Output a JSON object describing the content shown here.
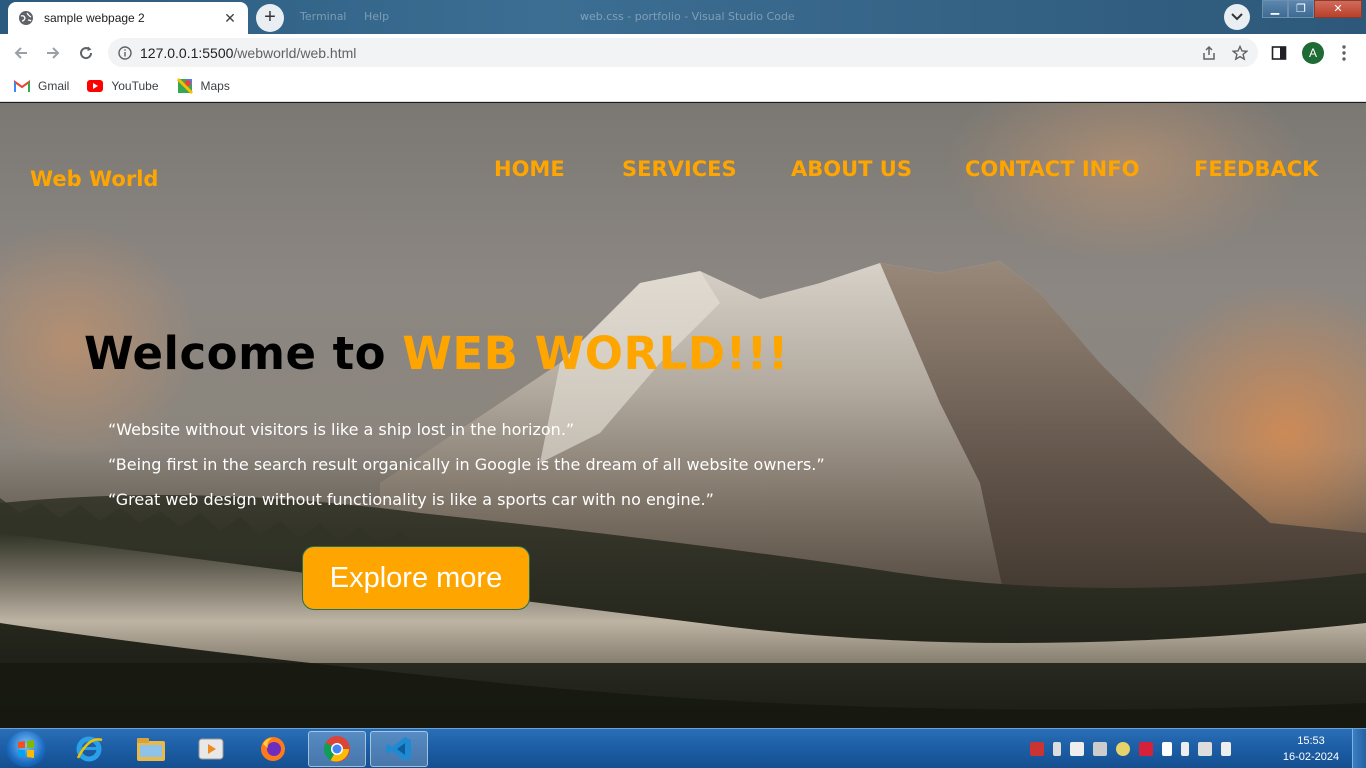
{
  "browser": {
    "tab_title": "sample webpage 2",
    "tab_close": "✕",
    "new_tab": "+",
    "url_host": "127.0.0.1:5500",
    "url_path": "/webworld/web.html",
    "profile_initial": "A",
    "titlebar_ghost": [
      "Terminal",
      "Help",
      "web.css - portfolio - Visual Studio Code"
    ],
    "bookmarks": [
      {
        "label": "Gmail",
        "icon": "gmail-icon"
      },
      {
        "label": "YouTube",
        "icon": "youtube-icon"
      },
      {
        "label": "Maps",
        "icon": "maps-icon"
      }
    ]
  },
  "site": {
    "logo": "Web World",
    "nav": [
      "HOME",
      "SERVICES",
      "ABOUT US",
      "CONTACT INFO",
      "FEEDBACK"
    ],
    "hero": {
      "title_lead": "Welcome to ",
      "title_accent": "WEB WORLD!!!"
    },
    "quotes": [
      "“Website without visitors is like a ship lost in the horizon.”",
      "“Being first in the search result organically in Google is the dream of all website owners.”",
      "“Great web design without functionality is like a sports car with no engine.”"
    ],
    "cta": "Explore more",
    "accent_color": "#ffa500"
  },
  "taskbar": {
    "apps": [
      "internet-explorer-icon",
      "file-explorer-icon",
      "media-player-icon",
      "firefox-icon",
      "chrome-icon",
      "vscode-icon"
    ],
    "time": "15:53",
    "date": "16-02-2024"
  }
}
